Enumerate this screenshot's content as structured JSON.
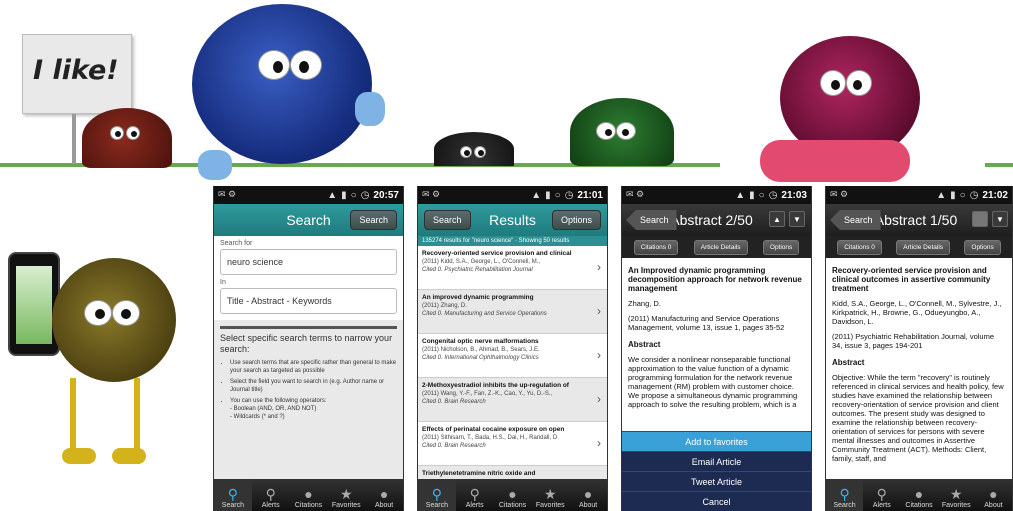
{
  "sign": {
    "text": "I like!"
  },
  "status": {
    "time_search": "20:57",
    "time_results": "21:01",
    "time_abstract2": "21:03",
    "time_abstract1": "21:02"
  },
  "search_screen": {
    "title": "Search",
    "search_button": "Search",
    "search_for_label": "Search for",
    "search_for_value": "neuro science",
    "in_label": "In",
    "in_value": "Title - Abstract - Keywords",
    "help_title": "Select specific search terms to narrow your search:",
    "help_items": [
      "Use search terms that are specific rather than general to make your search as targeted as possible",
      "Select the field you want to search in (e.g. Author name or Journal title)",
      "You can use the following operators:",
      "- Boolean (AND, OR, AND NOT)",
      "- Wildcards (* and ?)"
    ]
  },
  "results_screen": {
    "title": "Results",
    "search_button": "Search",
    "options_button": "Options",
    "banner": "135274 results for \"neuro science\" · Showing 50 results",
    "items": [
      {
        "title": "Recovery-oriented service provision and clinical",
        "meta": "(2011) Kidd, S.A., George, L., O'Connell, M.,",
        "cite": "Cited 0. Psychiatric Rehabilitation Journal"
      },
      {
        "title": "An improved dynamic programming",
        "meta": "(2011) Zhang, D.",
        "cite": "Cited 0. Manufacturing and Service Operations"
      },
      {
        "title": "Congenital optic nerve malformations",
        "meta": "(2011) Nicholson, B., Ahmad, B., Sears, J.E.",
        "cite": "Cited 0. International Ophthalmology Clinics"
      },
      {
        "title": "2-Methoxyestradiol inhibits the up-regulation of",
        "meta": "(2011) Wang, Y.-F., Fan, Z.-K., Cao, Y., Yu, D.-S.,",
        "cite": "Cited 0. Brain Research"
      },
      {
        "title": "Effects of perinatal cocaine exposure on open",
        "meta": "(2011) Sithisarn, T., Bada, H.S., Dai, H., Randall, D",
        "cite": "Cited 0. Brain Research"
      },
      {
        "title": "Triethylenetetramine nitric oxide and",
        "meta": "",
        "cite": ""
      }
    ]
  },
  "abstract2_screen": {
    "title": "Abstract 2/50",
    "search_button": "Search",
    "citations_button": "Citations 0",
    "details_button": "Article Details",
    "options_button": "Options",
    "paper_title": "An Improved dynamic programming decomposition approach for network revenue management",
    "author": "Zhang, D.",
    "source": "(2011) Manufacturing and Service Operations Management, volume 13, issue 1, pages 35-52",
    "abstract_heading": "Abstract",
    "abstract_text": "We consider a nonlinear nonseparable functional approximation to the value function of a dynamic programming formulation for the network revenue management (RM) problem with customer choice. We propose a simultaneous dynamic programming approach to solve the resulting problem, which is a",
    "sheet": [
      "Add to favorites",
      "Email Article",
      "Tweet Article",
      "Cancel"
    ]
  },
  "abstract1_screen": {
    "title": "Abstract 1/50",
    "search_button": "Search",
    "citations_button": "Citations 0",
    "details_button": "Article Details",
    "options_button": "Options",
    "paper_title": "Recovery-oriented service provision and clinical outcomes in assertive community treatment",
    "authors": "Kidd, S.A., George, L., O'Connell, M., Sylvestre, J., Kirkpatrick, H., Browne, G., Odueyungbo, A., Davidson, L.",
    "source": "(2011) Psychiatric Rehabilitation Journal, volume 34, issue 3, pages 194-201",
    "abstract_heading": "Abstract",
    "abstract_text": "Objective: While the term \"recovery\" is routinely referenced in clinical services and health policy, few studies have examined the relationship between recovery-orientation of service provision and client outcomes. The present study was designed to examine the relationship between recovery-orientation of services for persons with severe mental illnesses and outcomes in Assertive Community Treatment (ACT). Methods: Client, family, staff, and"
  },
  "tabbar": [
    "Search",
    "Alerts",
    "Citations",
    "Favorites",
    "About"
  ]
}
